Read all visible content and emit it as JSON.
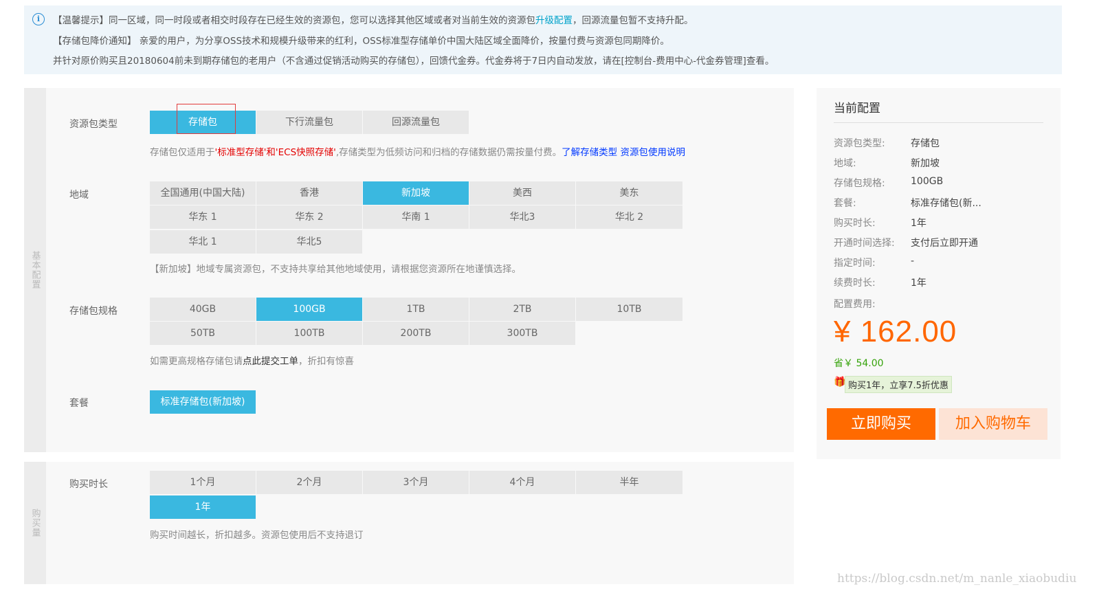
{
  "notice": {
    "line1_a": "【温馨提示】同一区域，同一时段或者相交时段存在已经生效的资源包，您可以选择其他区域或者对当前生效的资源包",
    "line1_link": "升级配置",
    "line1_b": "，回源流量包暂不支持升配。",
    "line2": "【存储包降价通知】 亲爱的用户，为分享OSS技术和规模升级带来的红利，OSS标准型存储单价中国大陆区域全面降价，按量付费与资源包同期降价。",
    "line3": "并针对原价购买且20180604前未到期存储包的老用户（不含通过促销活动购买的存储包），回馈代金券。代金券将于7日内自动发放，请在[控制台-费用中心-代金券管理]查看。"
  },
  "panel1": {
    "side_label": "基本配置",
    "package_type": {
      "label": "资源包类型",
      "options": [
        "存储包",
        "下行流量包",
        "回源流量包"
      ],
      "selected": 0,
      "hint_a": "存储包仅适用于",
      "hint_red": "'标准型存储'和'ECS快照存储'",
      "hint_b": ",存储类型为低频访问和归档的存储数据仍需按量付费。",
      "hint_link1": "了解存储类型",
      "hint_link2": "资源包使用说明"
    },
    "region": {
      "label": "地域",
      "options": [
        "全国通用(中国大陆)",
        "香港",
        "新加坡",
        "美西",
        "美东",
        "华东 1",
        "华东 2",
        "华南 1",
        "华北3",
        "华北 2",
        "华北 1",
        "华北5"
      ],
      "selected": 2,
      "hint": "【新加坡】地域专属资源包，不支持共享给其他地域使用，请根据您资源所在地谨慎选择。"
    },
    "spec": {
      "label": "存储包规格",
      "options": [
        "40GB",
        "100GB",
        "1TB",
        "2TB",
        "10TB",
        "50TB",
        "100TB",
        "200TB",
        "300TB"
      ],
      "selected": 1,
      "hint_a": "如需更高规格存储包请",
      "hint_b": "点此提交工单",
      "hint_c": "，折扣有惊喜"
    },
    "plan": {
      "label": "套餐",
      "option": "标准存储包(新加坡)"
    }
  },
  "panel2": {
    "side_label": "购买量",
    "duration": {
      "label": "购买时长",
      "options": [
        "1个月",
        "2个月",
        "3个月",
        "4个月",
        "半年",
        "1年"
      ],
      "selected": 5,
      "hint": "购买时间越长，折扣越多。资源包使用后不支持退订"
    }
  },
  "summary": {
    "title": "当前配置",
    "rows": [
      {
        "key": "资源包类型:",
        "val": "存储包"
      },
      {
        "key": "地域:",
        "val": "新加坡"
      },
      {
        "key": "存储包规格:",
        "val": "100GB"
      },
      {
        "key": "套餐:",
        "val": "标准存储包(新..."
      },
      {
        "key": "购买时长:",
        "val": "1年"
      },
      {
        "key": "开通时间选择:",
        "val": "支付后立即开通"
      },
      {
        "key": "指定时间:",
        "val": "-"
      },
      {
        "key": "续费时长:",
        "val": "1年"
      }
    ],
    "fee_label": "配置费用:",
    "price": "¥ 162.00",
    "save": "省￥ 54.00",
    "promo": "购买1年，立享7.5折优惠",
    "buy_now": "立即购买",
    "add_cart": "加入购物车"
  },
  "watermark": "https://blog.csdn.net/m_nanle_xiaobudiu",
  "colors": {
    "accent": "#3ab8e0",
    "price": "#ff6600",
    "buy": "#ff6a00",
    "link": "#0038ff"
  }
}
